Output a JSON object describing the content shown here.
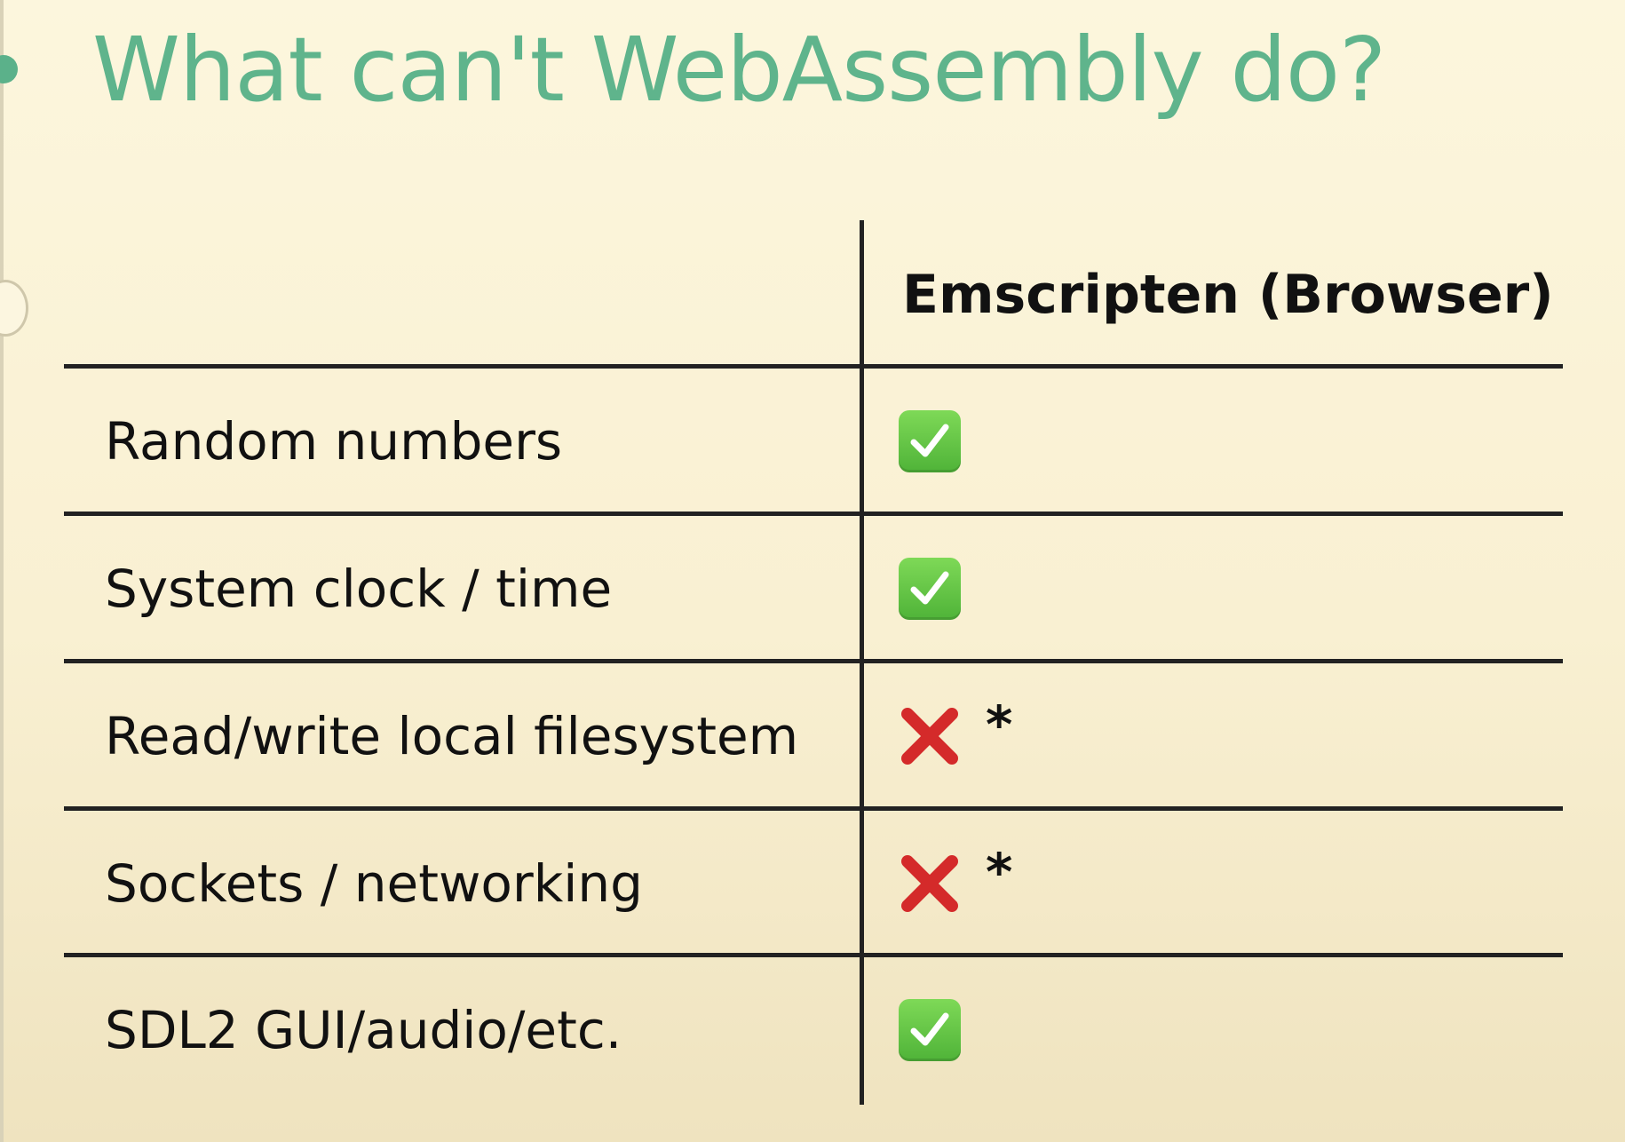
{
  "slide": {
    "title": "What can't WebAssembly do?"
  },
  "table": {
    "column_header": "Emscripten (Browser)",
    "rows": [
      {
        "label": "Random numbers",
        "status": "supported",
        "icon": "check-icon",
        "note": ""
      },
      {
        "label": "System clock / time",
        "status": "supported",
        "icon": "check-icon",
        "note": ""
      },
      {
        "label": "Read/write local filesystem",
        "status": "unsupported",
        "icon": "cross-icon",
        "note": "*"
      },
      {
        "label": "Sockets / networking",
        "status": "unsupported",
        "icon": "cross-icon",
        "note": "*"
      },
      {
        "label": "SDL2 GUI/audio/etc.",
        "status": "supported",
        "icon": "check-icon",
        "note": ""
      }
    ]
  },
  "colors": {
    "title": "#5fb48c",
    "check": "#5fc443",
    "cross": "#d42a2a",
    "background": "#fcf6dd"
  }
}
